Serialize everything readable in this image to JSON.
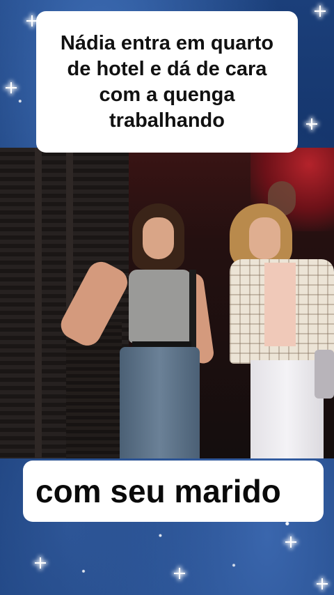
{
  "caption_top": {
    "text": "Nádia entra em quarto\nde hotel e dá de cara\ncom a quenga\ntrabalhando"
  },
  "caption_bottom": {
    "text": "com seu marido"
  },
  "colors": {
    "background": "#1b3f7a",
    "caption_bg": "#ffffff",
    "caption_text": "#111111"
  }
}
